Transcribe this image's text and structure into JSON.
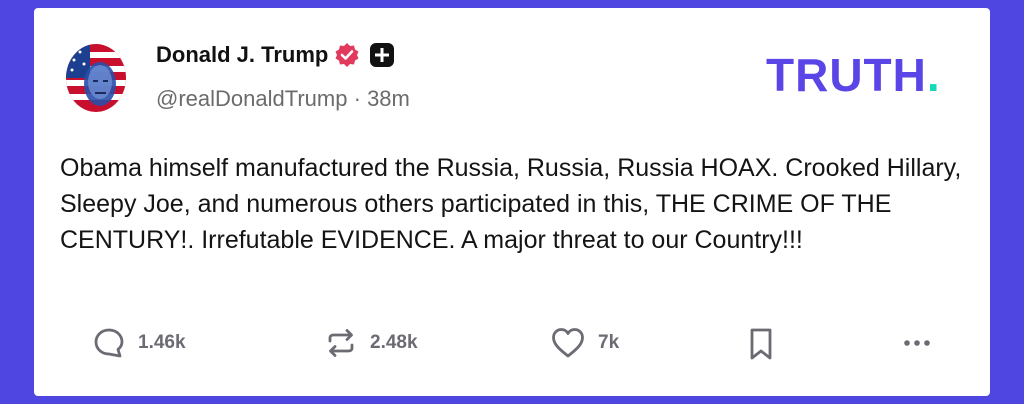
{
  "post": {
    "author_name": "Donald J. Trump",
    "handle": "@realDonaldTrump",
    "separator": "·",
    "time": "38m",
    "text": "Obama himself manufactured the Russia, Russia, Russia HOAX. Crooked Hillary, Sleepy Joe, and numerous others participated in this, THE CRIME OF THE CENTURY!. Irrefutable EVIDENCE. A major threat to our Country!!!"
  },
  "brand": {
    "logo_main": "TRUTH",
    "logo_dot": ".",
    "color": "#5a45e6",
    "dot_color": "#19d8b6"
  },
  "actions": {
    "replies": {
      "count": "1.46k",
      "icon": "reply-icon"
    },
    "retruths": {
      "count": "2.48k",
      "icon": "retruth-icon"
    },
    "likes": {
      "count": "7k",
      "icon": "heart-icon"
    },
    "bookmark": {
      "icon": "bookmark-icon"
    },
    "more": {
      "icon": "more-icon"
    }
  },
  "colors": {
    "background": "#4f46e2",
    "verified_badge": "#e23a5c",
    "muted_text": "#6b6b6b"
  }
}
